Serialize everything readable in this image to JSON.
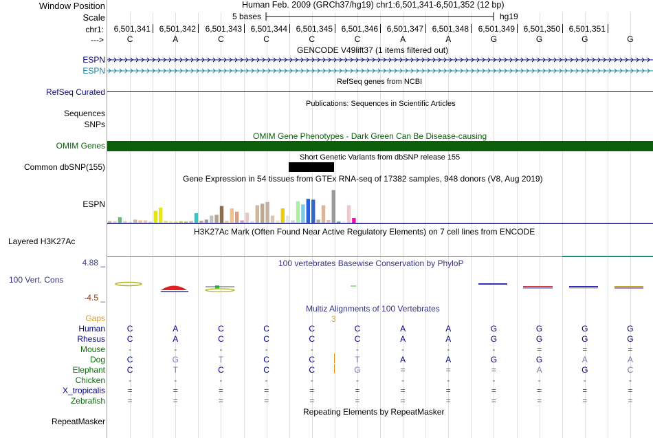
{
  "header": {
    "window_position_label": "Window Position",
    "scale_label": "Scale",
    "chr_label": "chr1:",
    "strand_label": "--->",
    "assembly_title": "Human Feb. 2009 (GRCh37/hg19)   chr1:6,501,341-6,501,352 (12 bp)",
    "scale_text": "5 bases",
    "scale_db": "hg19"
  },
  "ruler": {
    "positions": [
      "6,501,341",
      "6,501,342",
      "6,501,343",
      "6,501,344",
      "6,501,345",
      "6,501,346",
      "6,501,347",
      "6,501,348",
      "6,501,349",
      "6,501,350",
      "6,501,351"
    ],
    "bases": [
      "C",
      "A",
      "C",
      "C",
      "C",
      "C",
      "A",
      "A",
      "G",
      "G",
      "G",
      "G"
    ]
  },
  "tracks": {
    "gencode_title": "GENCODE V49lift37 (1 items filtered out)",
    "espn1_label": "ESPN",
    "espn2_label": "ESPN",
    "refseq_label": "RefSeq Curated",
    "refseq_title": "RefSeq genes from NCBI",
    "sequences_label": "Sequences",
    "publications_title": "Publications: Sequences in Scientific Articles",
    "snps_label": "SNPs",
    "omim_label": "OMIM Genes",
    "omim_title": "OMIM Gene Phenotypes - Dark Green Can Be Disease-causing",
    "dbsnp_label": "Common dbSNP(155)",
    "dbsnp_title": "Short Genetic Variants from dbSNP release 155",
    "gtex_title": "Gene Expression in 54 tissues from GTEx RNA-seq of 17382 samples, 948 donors (V8, Aug 2019)",
    "gtex_label": "ESPN",
    "h3k27_title": "H3K27Ac Mark (Often Found Near Active Regulatory Elements) on 7 cell lines from ENCODE",
    "h3k27_label": "Layered H3K27Ac",
    "cons_title": "100 vertebrates Basewise Conservation by PhyloP",
    "cons_max": "4.88 _",
    "cons_label": "100 Vert. Cons",
    "cons_min": "-4.5 _",
    "multiz_title": "Multiz Alignments of 100 Vertebrates",
    "gaps_label": "Gaps",
    "gap_count": "3",
    "repeat_title": "Repeating Elements by RepeatMasker",
    "repeat_label": "RepeatMasker"
  },
  "alignment": [
    {
      "species": "Human",
      "bases": [
        "C",
        "A",
        "C",
        "C",
        "C",
        "C",
        "A",
        "A",
        "G",
        "G",
        "G",
        "G"
      ]
    },
    {
      "species": "Rhesus",
      "bases": [
        "C",
        "A",
        "C",
        "C",
        "C",
        "C",
        "A",
        "A",
        "G",
        "G",
        "G",
        "G"
      ]
    },
    {
      "species": "Mouse",
      "bases": [
        "-",
        "-",
        "-",
        "-",
        "-",
        "-",
        "-",
        "-",
        "-",
        "=",
        "=",
        "="
      ]
    },
    {
      "species": "Dog",
      "bases": [
        "C",
        "G",
        "T",
        "C",
        "C",
        "T",
        "A",
        "A",
        "G",
        "G",
        "A",
        "A"
      ]
    },
    {
      "species": "Elephant",
      "bases": [
        "C",
        "T",
        "C",
        "C",
        "C",
        "G",
        "=",
        "=",
        "=",
        "A",
        "G",
        "C"
      ]
    },
    {
      "species": "Chicken",
      "bases": [
        "-",
        "-",
        "-",
        "-",
        "-",
        "-",
        "-",
        "-",
        "-",
        "-",
        "-",
        "-"
      ]
    },
    {
      "species": "X_tropicalis",
      "bases": [
        "=",
        "=",
        "=",
        "=",
        "=",
        "=",
        "=",
        "=",
        "=",
        "=",
        "=",
        "="
      ]
    },
    {
      "species": "Zebrafish",
      "bases": [
        "=",
        "=",
        "=",
        "=",
        "=",
        "=",
        "=",
        "=",
        "=",
        "=",
        "=",
        "="
      ]
    }
  ],
  "gtex_bars": [
    {
      "v": 0.04,
      "c": "#f1a380"
    },
    {
      "v": 0.04,
      "c": "#e6d0b2"
    },
    {
      "v": 0.14,
      "c": "#77b47b"
    },
    {
      "v": 0.04,
      "c": "#e1c7bd"
    },
    {
      "v": 0.02,
      "c": "#f5d0a8"
    },
    {
      "v": 0.08,
      "c": "#c8b6a6"
    },
    {
      "v": 0.06,
      "c": "#f0c080"
    },
    {
      "v": 0.06,
      "c": "#eec0b0"
    },
    {
      "v": 0.03,
      "c": "#d0d0d0"
    },
    {
      "v": 0.3,
      "c": "#e3e31a"
    },
    {
      "v": 0.38,
      "c": "#e6e61a"
    },
    {
      "v": 0.05,
      "c": "#e8e84f"
    },
    {
      "v": 0.04,
      "c": "#f0e68c"
    },
    {
      "v": 0.03,
      "c": "#dddd55"
    },
    {
      "v": 0.04,
      "c": "#cfcf30"
    },
    {
      "v": 0.03,
      "c": "#bbbb40"
    },
    {
      "v": 0.04,
      "c": "#b8b8a0"
    },
    {
      "v": 0.24,
      "c": "#33c6c6"
    },
    {
      "v": 0.05,
      "c": "#c9a46e"
    },
    {
      "v": 0.08,
      "c": "#9e9e9e"
    },
    {
      "v": 0.18,
      "c": "#c0c0c0"
    },
    {
      "v": 0.2,
      "c": "#b7a28a"
    },
    {
      "v": 0.42,
      "c": "#8b6d4f"
    },
    {
      "v": 0.05,
      "c": "#f4c47c"
    },
    {
      "v": 0.36,
      "c": "#f4c08c"
    },
    {
      "v": 0.28,
      "c": "#d7a28a"
    },
    {
      "v": 0.06,
      "c": "#cc9fbd"
    },
    {
      "v": 0.25,
      "c": "#ecc6c6"
    },
    {
      "v": 0.04,
      "c": "#e0d0e0"
    },
    {
      "v": 0.44,
      "c": "#cdb79e"
    },
    {
      "v": 0.48,
      "c": "#bfa690"
    },
    {
      "v": 0.52,
      "c": "#c8b0a0"
    },
    {
      "v": 0.18,
      "c": "#d9c5b0"
    },
    {
      "v": 0.06,
      "c": "#f0e0d0"
    },
    {
      "v": 0.36,
      "c": "#e8d000"
    },
    {
      "v": 0.18,
      "c": "#e6e6e6"
    },
    {
      "v": 0.06,
      "c": "#d0d0d0"
    },
    {
      "v": 0.54,
      "c": "#aaf0a0"
    },
    {
      "v": 0.46,
      "c": "#80c8e8"
    },
    {
      "v": 0.6,
      "c": "#2a5fe0"
    },
    {
      "v": 0.58,
      "c": "#3366cc"
    },
    {
      "v": 0.08,
      "c": "#aaaaaa"
    },
    {
      "v": 0.44,
      "c": "#d9b79e"
    },
    {
      "v": 0.07,
      "c": "#e0c0b0"
    },
    {
      "v": 0.82,
      "c": "#999999"
    },
    {
      "v": 0.03,
      "c": "#44aa99"
    },
    {
      "v": 0.04,
      "c": "#f0f0f0"
    },
    {
      "v": 0.44,
      "c": "#f0c8c8"
    },
    {
      "v": 0.12,
      "c": "#ff00bb"
    }
  ],
  "colors": {
    "espn_dark": "#000080",
    "espn_teal": "#1188aa",
    "refseq": "#0c0c78",
    "omim": "#0b5f0b",
    "omim_text": "#0b5f0b",
    "cons_label": "#333388",
    "cons_max": "#3a3a9a",
    "cons_min": "#8a3a1a",
    "gaps": "#e39a1a",
    "species_blue": "#000080",
    "species_green": "#0b6b0b",
    "grid": "#e0e0e0",
    "divider": "#cc8888",
    "h3k27": "#1c8d7d"
  }
}
